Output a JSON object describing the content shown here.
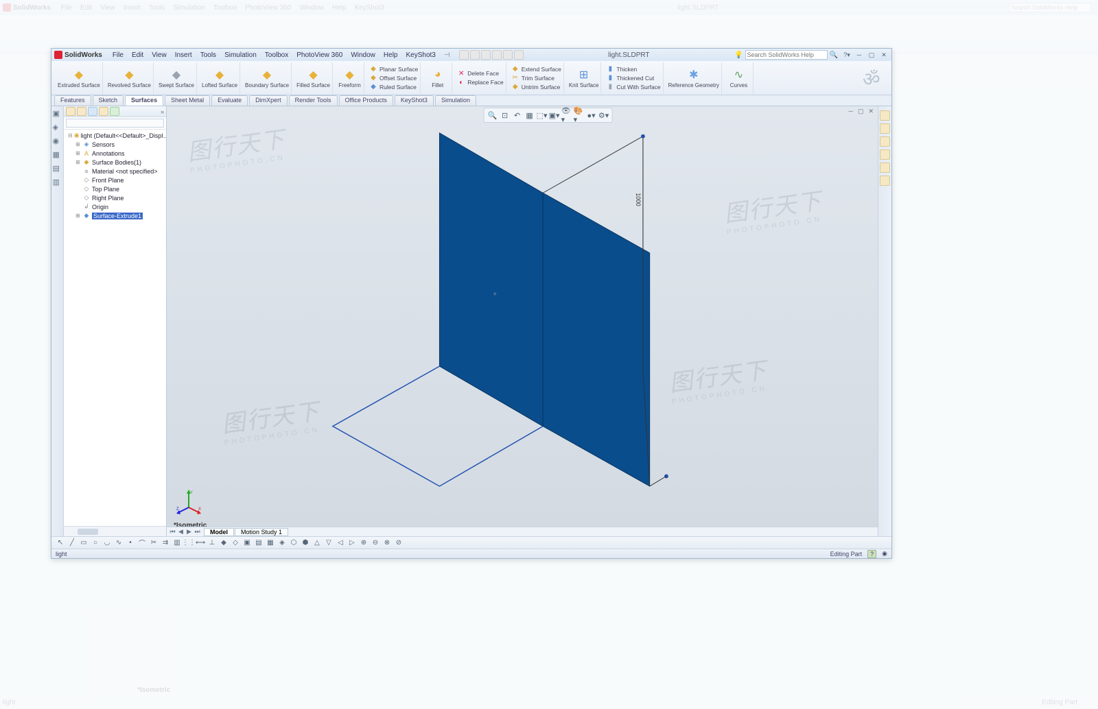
{
  "app": {
    "brand": "SolidWorks",
    "docname": "light.SLDPRT"
  },
  "menu": [
    "File",
    "Edit",
    "View",
    "Insert",
    "Tools",
    "Simulation",
    "Toolbox",
    "PhotoView 360",
    "Window",
    "Help",
    "KeyShot3"
  ],
  "search": {
    "placeholder": "Search SolidWorks Help"
  },
  "ribbon_big": [
    {
      "label": "Extruded\nSurface",
      "color": "#e8b23a"
    },
    {
      "label": "Revolved\nSurface",
      "color": "#e8b23a"
    },
    {
      "label": "Swept\nSurface",
      "color": "#9aa4b0"
    },
    {
      "label": "Lofted\nSurface",
      "color": "#e8b23a"
    },
    {
      "label": "Boundary\nSurface",
      "color": "#e8b23a"
    },
    {
      "label": "Filled\nSurface",
      "color": "#e8b23a"
    },
    {
      "label": "Freeform",
      "color": "#e8b23a"
    }
  ],
  "ribbon_col1": [
    {
      "icon": "◆",
      "color": "#d9a93a",
      "label": "Planar Surface"
    },
    {
      "icon": "◆",
      "color": "#d9a93a",
      "label": "Offset Surface"
    },
    {
      "icon": "◆",
      "color": "#5a8fd6",
      "label": "Ruled Surface"
    }
  ],
  "ribbon_fillet": {
    "label": "Fillet"
  },
  "ribbon_col2": [
    {
      "icon": "✕",
      "color": "#d25",
      "label": "Delete Face"
    },
    {
      "icon": "◐",
      "color": "#d25",
      "label": "Replace Face"
    }
  ],
  "ribbon_col3": [
    {
      "icon": "◆",
      "color": "#d9a93a",
      "label": "Extend Surface"
    },
    {
      "icon": "✂",
      "color": "#d9a93a",
      "label": "Trim Surface"
    },
    {
      "icon": "◆",
      "color": "#d9a93a",
      "label": "Untrim Surface"
    }
  ],
  "ribbon_knit": {
    "label": "Knit\nSurface"
  },
  "ribbon_col4": [
    {
      "icon": "▮",
      "color": "#5a8fd6",
      "label": "Thicken"
    },
    {
      "icon": "▮",
      "color": "#5a8fd6",
      "label": "Thickened Cut"
    },
    {
      "icon": "▮",
      "color": "#9aa4b0",
      "label": "Cut With Surface"
    }
  ],
  "ribbon_ref": {
    "label": "Reference\nGeometry"
  },
  "ribbon_curves": {
    "label": "Curves"
  },
  "cmd_tabs": [
    "Features",
    "Sketch",
    "Surfaces",
    "Sheet Metal",
    "Evaluate",
    "DimXpert",
    "Render Tools",
    "Office Products",
    "KeyShot3",
    "Simulation"
  ],
  "cmd_active": 2,
  "tree": {
    "root": "light  (Default<<Default>_Displ…",
    "items": [
      {
        "icon": "◈",
        "color": "#5a8fd6",
        "label": "Sensors",
        "exp": "⊞"
      },
      {
        "icon": "A",
        "color": "#d9a93a",
        "label": "Annotations",
        "exp": "⊞"
      },
      {
        "icon": "◆",
        "color": "#d9a93a",
        "label": "Surface Bodies(1)",
        "exp": "⊞"
      },
      {
        "icon": "≡",
        "color": "#888",
        "label": "Material <not specified>",
        "exp": ""
      },
      {
        "icon": "◇",
        "color": "#888",
        "label": "Front Plane",
        "exp": ""
      },
      {
        "icon": "◇",
        "color": "#888",
        "label": "Top Plane",
        "exp": ""
      },
      {
        "icon": "◇",
        "color": "#888",
        "label": "Right Plane",
        "exp": ""
      },
      {
        "icon": "�downarrow",
        "color": "#888",
        "label": "Origin",
        "exp": ""
      },
      {
        "icon": "◆",
        "color": "#5a8fd6",
        "label": "Surface-Extrude1",
        "exp": "⊞",
        "sel": true
      }
    ]
  },
  "view_label": "*Isometric",
  "bottom_tabs": [
    "Model",
    "Motion Study 1"
  ],
  "bottom_active": 0,
  "status": {
    "left": "light",
    "right": "Editing Part"
  },
  "outer_status": {
    "left": "light",
    "right": "Editing Part"
  },
  "watermark": {
    "main": "图行天下",
    "sub": "PHOTOPHOTO.CN"
  }
}
